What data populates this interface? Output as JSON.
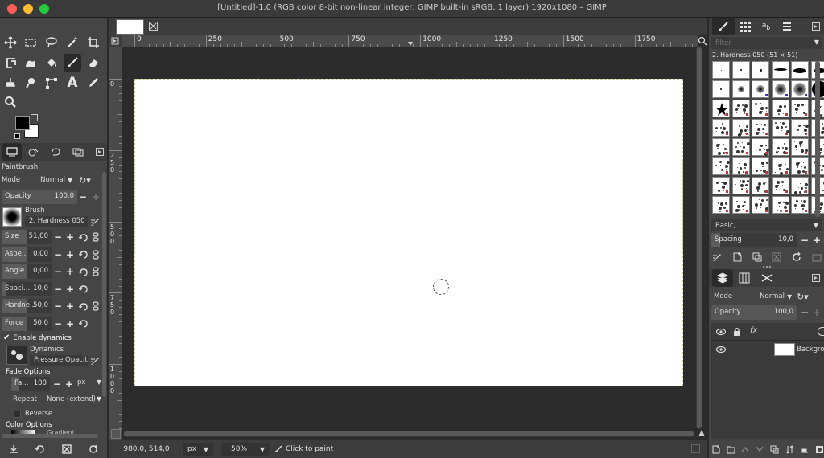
{
  "window": {
    "title": "[Untitled]-1.0 (RGB color 8-bit non-linear integer, GIMP built-in sRGB, 1 layer) 1920x1080 – GIMP",
    "colors": {
      "close": "#ff5f57",
      "minimize": "#febc2e",
      "maximize": "#28c840"
    }
  },
  "toolbox": {
    "tools": [
      "move-icon",
      "rect-select-icon",
      "lasso-icon",
      "fuzzy-select-icon",
      "crop-icon",
      "unified-transform-icon",
      "warp-icon",
      "bucket-fill-icon",
      "paintbrush-icon",
      "eraser-icon",
      "clone-icon",
      "smudge-icon",
      "paths-icon",
      "text-icon",
      "color-picker-icon",
      "zoom-icon"
    ],
    "tabs": [
      "tool-options-icon",
      "device-status-icon",
      "undo-history-icon",
      "images-icon"
    ]
  },
  "tool_options": {
    "title": "Paintbrush",
    "mode_label": "Mode",
    "mode_value": "Normal",
    "opacity_label": "Opacity",
    "opacity_value": "100,0",
    "brush_label": "Brush",
    "brush_name": "2. Hardness 050",
    "size_label": "Size",
    "size_value": "51,00",
    "aspect_label": "Aspe...",
    "aspect_value": "0,00",
    "angle_label": "Angle",
    "angle_value": "0,00",
    "spacing_label": "Spaci...",
    "spacing_value": "10,0",
    "hardness_label": "Hardne...",
    "hardness_value": "50,0",
    "force_label": "Force",
    "force_value": "50,0",
    "enable_dynamics": "Enable dynamics",
    "dynamics_label": "Dynamics",
    "dynamics_value": "Pressure Opacit",
    "fade_options": "Fade Options",
    "fade_label": "Fa...",
    "fade_value": "100",
    "fade_unit": "px",
    "repeat_label": "Repeat",
    "repeat_value": "None (extend)",
    "reverse": "Reverse",
    "color_options": "Color Options",
    "gradient": "Gradient"
  },
  "ruler": {
    "top_labels": [
      "0",
      "250",
      "500",
      "750",
      "1000",
      "1250",
      "1500",
      "1750"
    ],
    "left_labels": [
      "0",
      "250",
      "500",
      "750",
      "1000"
    ]
  },
  "status": {
    "coords": "980,0, 514,0",
    "unit": "px",
    "zoom": "50%",
    "message": "Click to paint"
  },
  "brushes": {
    "filter_placeholder": "filter",
    "selected": "2. Hardness 050 (51 × 51)",
    "tag": "Basic,",
    "spacing_label": "Spacing",
    "spacing_value": "10,0"
  },
  "layers": {
    "mode_label": "Mode",
    "mode_value": "Normal",
    "opacity_label": "Opacity",
    "opacity_value": "100,0",
    "layer_name": "Backgrou"
  }
}
